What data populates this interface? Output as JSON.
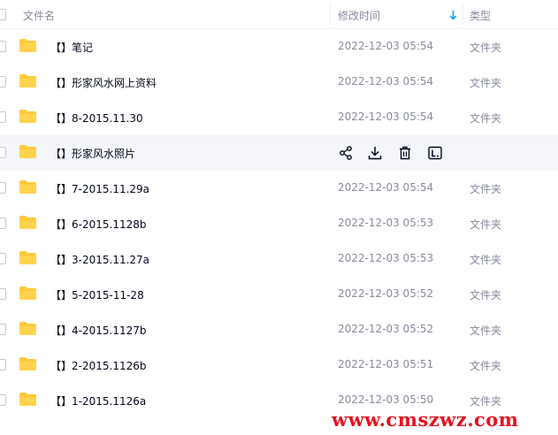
{
  "header": {
    "name_label": "文件名",
    "time_label": "修改时间",
    "type_label": "类型",
    "sort_icon": "arrow-down-icon"
  },
  "rows": [
    {
      "name": "【】笔记",
      "time": "2022-12-03 05:54",
      "type": "文件夹"
    },
    {
      "name": "【】形家风水网上资料",
      "time": "2022-12-03 05:54",
      "type": "文件夹"
    },
    {
      "name": "【】8-2015.11.30",
      "time": "2022-12-03 05:54",
      "type": "文件夹"
    },
    {
      "name": "【】形家风水照片",
      "time": "",
      "type": "",
      "hovered": true,
      "actions": [
        "share-icon",
        "download-icon",
        "delete-icon",
        "rename-icon"
      ]
    },
    {
      "name": "【】7-2015.11.29a",
      "time": "2022-12-03 05:54",
      "type": "文件夹"
    },
    {
      "name": "【】6-2015.1128b",
      "time": "2022-12-03 05:53",
      "type": "文件夹"
    },
    {
      "name": "【】3-2015.11.27a",
      "time": "2022-12-03 05:53",
      "type": "文件夹"
    },
    {
      "name": "【】5-2015-11-28",
      "time": "2022-12-03 05:52",
      "type": "文件夹"
    },
    {
      "name": "【】4-2015.1127b",
      "time": "2022-12-03 05:52",
      "type": "文件夹"
    },
    {
      "name": "【】2-2015.1126b",
      "time": "2022-12-03 05:51",
      "type": "文件夹"
    },
    {
      "name": "【】1-2015.1126a",
      "time": "2022-12-03 05:50",
      "type": "文件夹"
    }
  ],
  "watermark": "www.cmszwz.com",
  "colors": {
    "folder": "#ffc93c",
    "accent": "#06a7ff",
    "hover_row": "#f5f6fa",
    "watermark": "#e8101f"
  }
}
